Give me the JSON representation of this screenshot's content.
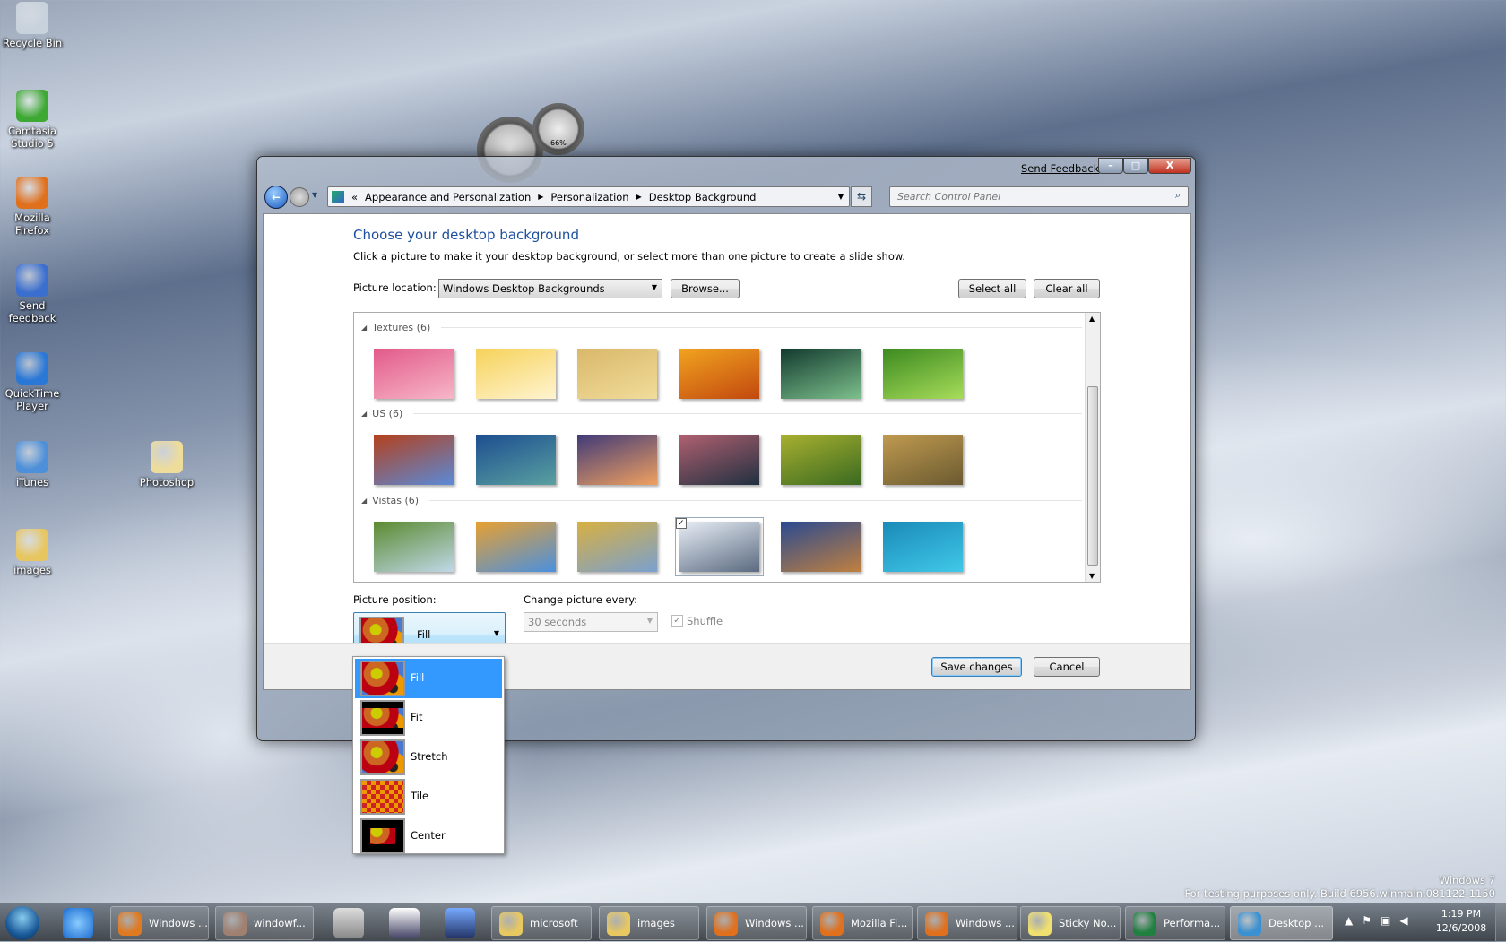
{
  "desktop": {
    "icons": [
      {
        "label": "Recycle Bin",
        "color": "#c8d2dc"
      },
      {
        "label": "Camtasia Studio 5",
        "color": "#3da832"
      },
      {
        "label": "Mozilla Firefox",
        "color": "#e0701c"
      },
      {
        "label": "Send feedback",
        "color": "#3b6fcf"
      },
      {
        "label": "QuickTime Player",
        "color": "#2a78d6"
      },
      {
        "label": "iTunes",
        "color": "#4d8fd8"
      },
      {
        "label": "images",
        "color": "#e7c660"
      },
      {
        "label": "Photoshop",
        "color": "#eedc9a"
      }
    ],
    "gadget_cpu_label": "66%",
    "watermark_line1": "Windows 7",
    "watermark_line2": "For testing purposes only. Build 6956.winmain.081122-1150"
  },
  "window": {
    "send_feedback": "Send Feedback",
    "caption": {
      "minimize": "–",
      "maximize": "□",
      "close": "X"
    },
    "breadcrumb": [
      "«",
      "Appearance and Personalization",
      "Personalization",
      "Desktop Background"
    ],
    "search_placeholder": "Search Control Panel",
    "title": "Choose your desktop background",
    "subtitle": "Click a picture to make it your desktop background, or select more than one picture to create a slide show.",
    "picture_location_label": "Picture location:",
    "picture_location_value": "Windows Desktop Backgrounds",
    "browse": "Browse...",
    "select_all": "Select all",
    "clear_all": "Clear all",
    "groups": [
      {
        "name": "Textures (6)",
        "thumbs": [
          [
            "#e25a8a",
            "#f7b6c8"
          ],
          [
            "#f6d25a",
            "#fff4d0"
          ],
          [
            "#d9b86a",
            "#f1dc9a"
          ],
          [
            "#f1a320",
            "#c2480e"
          ],
          [
            "#123a2e",
            "#7dc08c"
          ],
          [
            "#3c8a20",
            "#a7dc5a"
          ]
        ]
      },
      {
        "name": "US (6)",
        "thumbs": [
          [
            "#b4401c",
            "#5a8ad8"
          ],
          [
            "#1c4e90",
            "#5aa0a0"
          ],
          [
            "#403a78",
            "#f0a060"
          ],
          [
            "#b06070",
            "#203040"
          ],
          [
            "#a8b030",
            "#3a6a20"
          ],
          [
            "#c09a50",
            "#6a5a30"
          ]
        ]
      },
      {
        "name": "Vistas (6)",
        "thumbs": [
          [
            "#5a8a30",
            "#c0d8e8"
          ],
          [
            "#e8a030",
            "#4a90e0"
          ],
          [
            "#d8b040",
            "#7aa0d0"
          ],
          [
            "#e8eef6",
            "#5a6a80"
          ],
          [
            "#2a4a90",
            "#c08040"
          ],
          [
            "#1a8ab8",
            "#40c8e8"
          ]
        ]
      }
    ],
    "selected_thumb": "Vistas-4",
    "picture_position_label": "Picture position:",
    "picture_position_value": "Fill",
    "position_options": [
      "Fill",
      "Fit",
      "Stretch",
      "Tile",
      "Center"
    ],
    "change_every_label": "Change picture every:",
    "change_every_value": "30 seconds",
    "shuffle_label": "Shuffle",
    "shuffle_checked": true,
    "save_changes": "Save changes",
    "cancel": "Cancel"
  },
  "taskbar": {
    "items": [
      {
        "label": "Windows ...",
        "color": "#e07a20"
      },
      {
        "label": "windowf...",
        "color": "#a08070"
      },
      {
        "label": "microsoft",
        "color": "#e8c860"
      },
      {
        "label": "images",
        "color": "#e8c860"
      },
      {
        "label": "Windows ...",
        "color": "#e0701c"
      },
      {
        "label": "Mozilla Fi...",
        "color": "#e0701c"
      },
      {
        "label": "Windows ...",
        "color": "#e0701c"
      },
      {
        "label": "Sticky No...",
        "color": "#f0e070"
      },
      {
        "label": "Performa...",
        "color": "#208040"
      },
      {
        "label": "Desktop ...",
        "color": "#3a90d0"
      }
    ],
    "clock_time": "1:19 PM",
    "clock_date": "12/6/2008"
  }
}
